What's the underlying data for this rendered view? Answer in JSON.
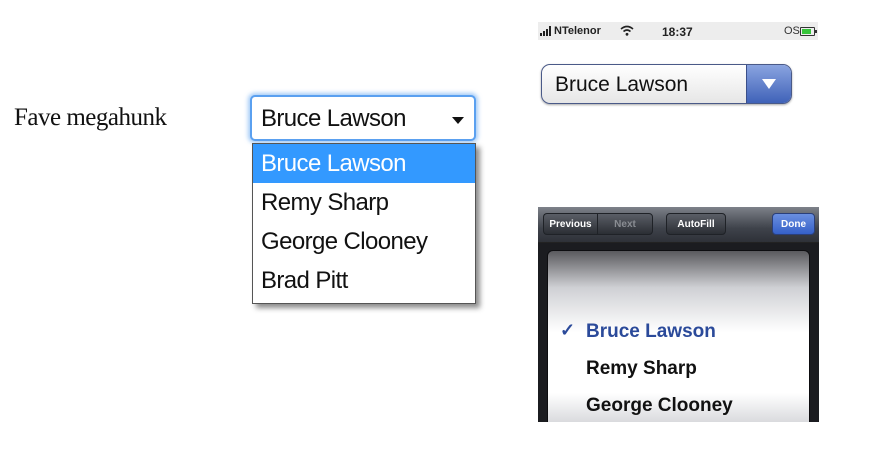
{
  "desktop": {
    "label": "Fave megahunk",
    "selected_value": "Bruce Lawson",
    "options": [
      "Bruce Lawson",
      "Remy Sharp",
      "George Clooney",
      "Brad Pitt"
    ],
    "highlight_color": "#3399ff"
  },
  "ios_status_bar": {
    "carrier": "NTelenor",
    "time": "18:37",
    "os_label": "OS"
  },
  "ios_select": {
    "selected_value": "Bruce Lawson",
    "button_color": "#4a6bc4"
  },
  "ios_picker": {
    "toolbar": {
      "previous": "Previous",
      "next": "Next",
      "autofill": "AutoFill",
      "done": "Done"
    },
    "check_mark": "✓",
    "items": [
      "Bruce Lawson",
      "Remy Sharp",
      "George Clooney"
    ],
    "checked_index": 0
  }
}
